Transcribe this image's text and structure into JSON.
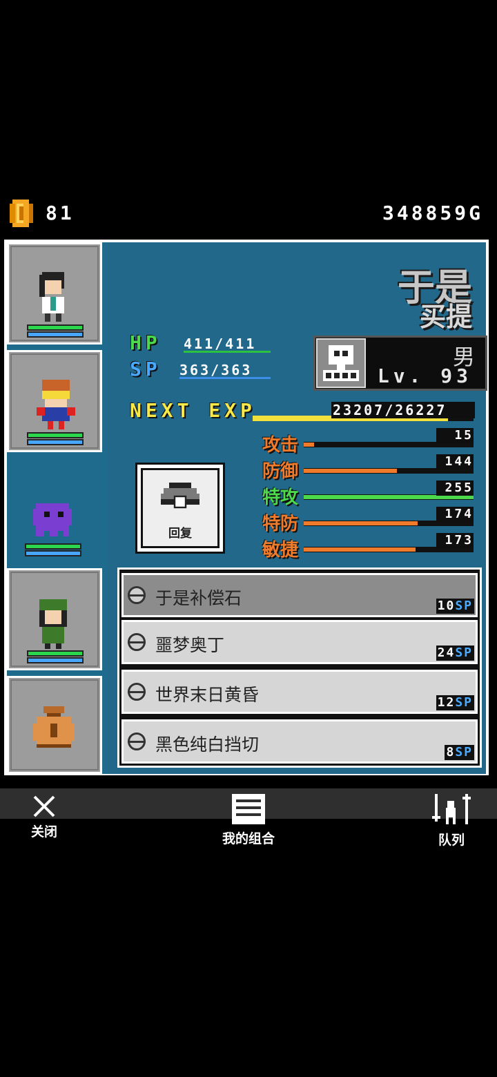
{
  "header": {
    "coin_count": "81",
    "gold": "348859G"
  },
  "character": {
    "name_line1": "于是",
    "name_line2": "买提",
    "gender": "男",
    "level": "Lv. 93",
    "hp_label": "HP",
    "hp_value": "411/411",
    "sp_label": "SP",
    "sp_value": "363/363",
    "exp_label": "NEXT EXP",
    "exp_value": "23207/26227",
    "exp_current": 23207,
    "exp_max": 26227
  },
  "stats": [
    {
      "label": "攻击",
      "value": "15",
      "color": "#f07b2a",
      "fraction": 0.06
    },
    {
      "label": "防御",
      "value": "144",
      "color": "#f07b2a",
      "fraction": 0.55
    },
    {
      "label": "特攻",
      "value": "255",
      "color": "#4cd94c",
      "fraction": 1.0
    },
    {
      "label": "特防",
      "value": "174",
      "color": "#f07b2a",
      "fraction": 0.67
    },
    {
      "label": "敏捷",
      "value": "173",
      "color": "#f07b2a",
      "fraction": 0.66
    }
  ],
  "recover_button": {
    "label": "回复"
  },
  "skills": [
    {
      "name": "于是补偿石",
      "cost": "10",
      "unit": "SP",
      "selected": true
    },
    {
      "name": "噩梦奥丁",
      "cost": "24",
      "unit": "SP",
      "selected": false
    },
    {
      "name": "世界末日黄昏",
      "cost": "12",
      "unit": "SP",
      "selected": false
    },
    {
      "name": "黑色纯白挡切",
      "cost": "8",
      "unit": "SP",
      "selected": false
    }
  ],
  "party_slots": [
    "girl-white-uniform",
    "boy-visor-hero",
    "purple-ghost",
    "girl-green-cap",
    "item-bag"
  ],
  "nav": {
    "close": "关闭",
    "combo": "我的组合",
    "queue": "队列"
  },
  "colors": {
    "panel": "#21688b",
    "hp": "#2bd84d",
    "sp": "#47a7ff",
    "exp": "#f2e13c",
    "stat_orange": "#f07b2a"
  }
}
